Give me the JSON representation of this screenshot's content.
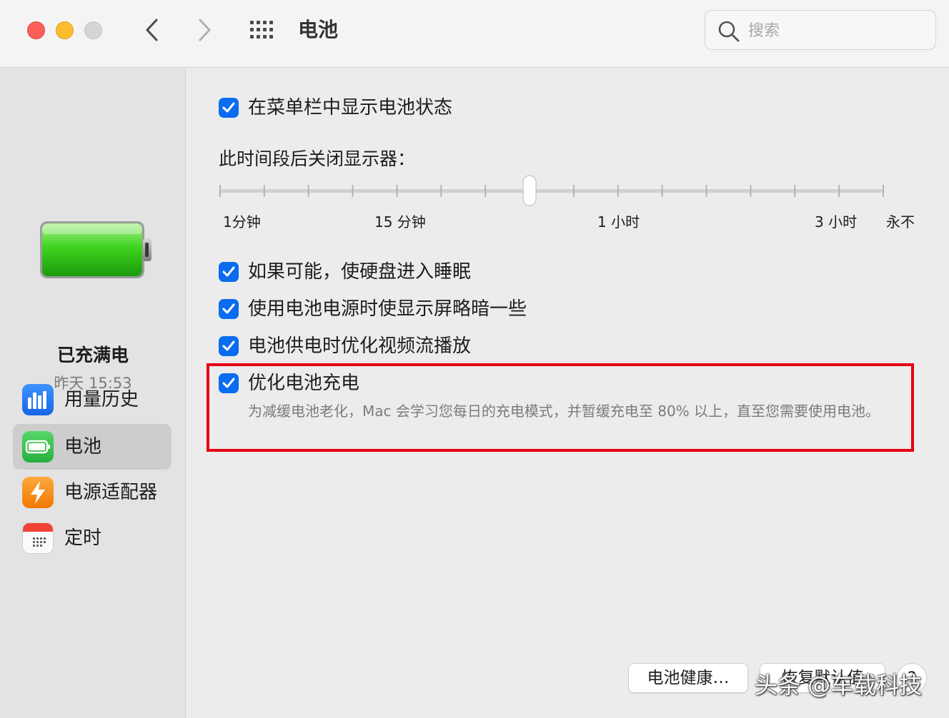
{
  "window": {
    "title": "电池",
    "search_placeholder": "搜索"
  },
  "sidebar": {
    "status_title": "已充满电",
    "status_time": "昨天 15:53",
    "items": [
      {
        "label": "用量历史",
        "icon": "chart-bars-icon",
        "selected": false
      },
      {
        "label": "电池",
        "icon": "battery-icon",
        "selected": true
      },
      {
        "label": "电源适配器",
        "icon": "lightning-icon",
        "selected": false
      },
      {
        "label": "定时",
        "icon": "calendar-icon",
        "selected": false
      }
    ]
  },
  "main": {
    "show_status_menu": {
      "label": "在菜单栏中显示电池状态",
      "checked": true
    },
    "display_off": {
      "title": "此时间段后关闭显示器：",
      "tick_labels": [
        "1分钟",
        "15 分钟",
        "1 小时",
        "3 小时",
        "永不"
      ],
      "selected_tick_index": 7,
      "tick_count": 16
    },
    "options": [
      {
        "label": "如果可能，使硬盘进入睡眠",
        "checked": true
      },
      {
        "label": "使用电池电源时使显示屏略暗一些",
        "checked": true
      },
      {
        "label": "电池供电时优化视频流播放",
        "checked": true
      }
    ],
    "optimized_charging": {
      "label": "优化电池充电",
      "checked": true,
      "description": "为减缓电池老化，Mac 会学习您每日的充电模式，并暂缓充电至 80% 以上，直至您需要使用电池。"
    },
    "buttons": {
      "health": "电池健康…",
      "restore": "恢复默认值",
      "help": "?"
    }
  },
  "watermark": "头条 @车载科技",
  "colors": {
    "accent": "#0a6cf0",
    "highlight": "#e60012",
    "battery_green": "#2fc11c"
  }
}
